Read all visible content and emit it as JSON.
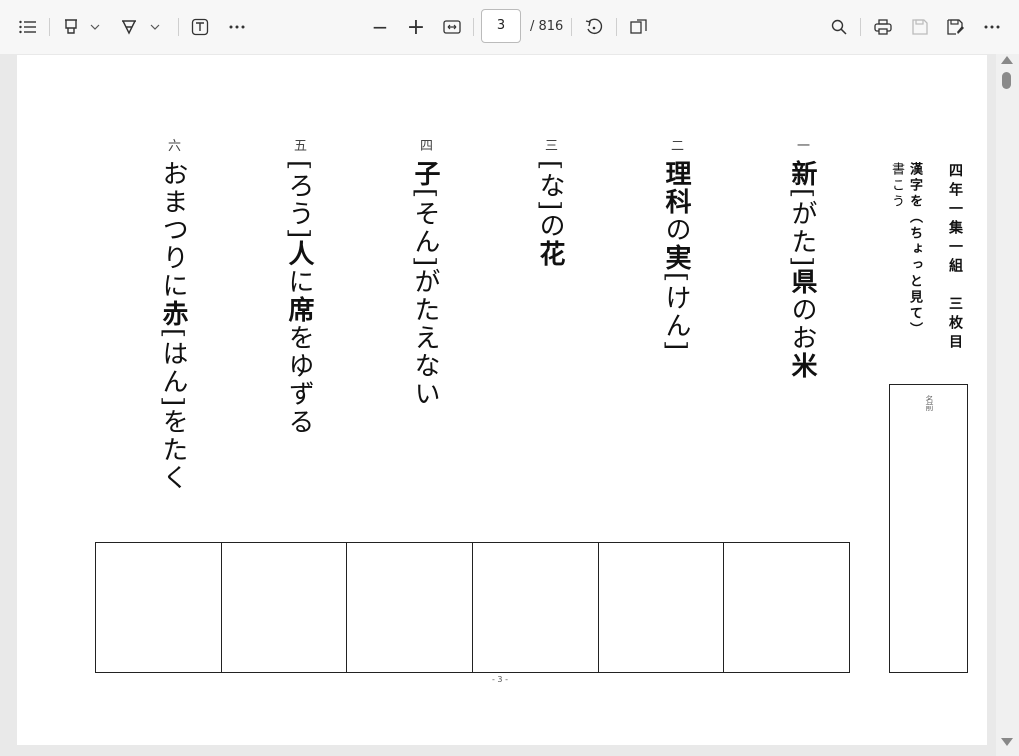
{
  "toolbar": {
    "contents_icon": "list-icon",
    "highlight_icon": "highlighter-icon",
    "draw_icon": "draw-icon",
    "text_icon": "text-box-icon",
    "more_icon": "more-icon",
    "zoom_out": "−",
    "zoom_in": "+",
    "fit_icon": "fit-width-icon",
    "current_page": "3",
    "total_pages": "/ 816",
    "rotate_icon": "rotate-icon",
    "page_view_icon": "page-view-icon",
    "search_icon": "search-icon",
    "print_icon": "print-icon",
    "save_icon": "save-icon",
    "save_as_icon": "save-as-icon",
    "overflow_icon": "more-icon"
  },
  "worksheet": {
    "title": "四年一集一組　三枚目",
    "instruction_line1": "漢字を（ちょっと見て）",
    "instruction_line2": "書こう",
    "name_label": "名前",
    "footer": "- 3 -",
    "questions": [
      {
        "num": "一",
        "parts": [
          {
            "t": "新",
            "b": true
          },
          {
            "t": "[がた]",
            "b": false
          },
          {
            "t": "県",
            "b": true
          },
          {
            "t": "のお",
            "b": false
          },
          {
            "t": "米",
            "b": true
          }
        ]
      },
      {
        "num": "二",
        "parts": [
          {
            "t": "理科",
            "b": true
          },
          {
            "t": "の",
            "b": false
          },
          {
            "t": "実",
            "b": true
          },
          {
            "t": "[けん]",
            "b": false
          }
        ]
      },
      {
        "num": "三",
        "parts": [
          {
            "t": "[な]",
            "b": false
          },
          {
            "t": "の",
            "b": false
          },
          {
            "t": "花",
            "b": true
          }
        ]
      },
      {
        "num": "四",
        "parts": [
          {
            "t": "子",
            "b": true
          },
          {
            "t": "[そん]",
            "b": false
          },
          {
            "t": "がたえない",
            "b": false
          }
        ]
      },
      {
        "num": "五",
        "parts": [
          {
            "t": "[ろう]",
            "b": false
          },
          {
            "t": "人",
            "b": true
          },
          {
            "t": "に",
            "b": false
          },
          {
            "t": "席",
            "b": true
          },
          {
            "t": "をゆずる",
            "b": false
          }
        ]
      },
      {
        "num": "六",
        "parts": [
          {
            "t": "おまつりに",
            "b": false
          },
          {
            "t": "赤",
            "b": true
          },
          {
            "t": "[はん]",
            "b": false
          },
          {
            "t": "をたく",
            "b": false
          }
        ]
      }
    ]
  }
}
